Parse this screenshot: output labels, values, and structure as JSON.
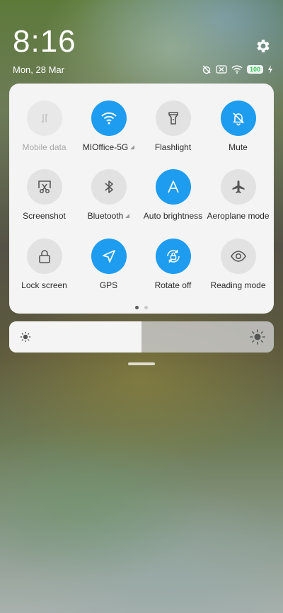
{
  "status_bar": {
    "time": "8:16",
    "date": "Mon, 28 Mar",
    "battery_level": "100",
    "icons": [
      "alarm-off-icon",
      "sim-off-icon",
      "wifi-icon",
      "battery-icon",
      "charging-icon"
    ]
  },
  "settings_icon": "gear-icon",
  "accent_color": "#1e9cf0",
  "quick_settings": {
    "tiles": [
      {
        "label": "Mobile data",
        "icon": "mobile-data-icon",
        "state": "disabled"
      },
      {
        "label": "MIOffice-5G",
        "icon": "wifi-icon",
        "state": "on"
      },
      {
        "label": "Flashlight",
        "icon": "flashlight-icon",
        "state": "off"
      },
      {
        "label": "Mute",
        "icon": "bell-off-icon",
        "state": "on"
      },
      {
        "label": "Screenshot",
        "icon": "screenshot-icon",
        "state": "off"
      },
      {
        "label": "Bluetooth",
        "icon": "bluetooth-icon",
        "state": "off"
      },
      {
        "label": "Auto brightness",
        "icon": "auto-brightness-icon",
        "state": "on"
      },
      {
        "label": "Aeroplane mode",
        "icon": "airplane-icon",
        "state": "off"
      },
      {
        "label": "Lock screen",
        "icon": "lock-icon",
        "state": "off"
      },
      {
        "label": "GPS",
        "icon": "gps-icon",
        "state": "on"
      },
      {
        "label": "Rotate off",
        "icon": "rotate-lock-icon",
        "state": "on"
      },
      {
        "label": "Reading mode",
        "icon": "eye-icon",
        "state": "off"
      }
    ],
    "page_count": 2,
    "current_page": 1
  },
  "brightness": {
    "level": 0.5,
    "low_icon": "brightness-low-icon",
    "high_icon": "brightness-high-icon"
  }
}
